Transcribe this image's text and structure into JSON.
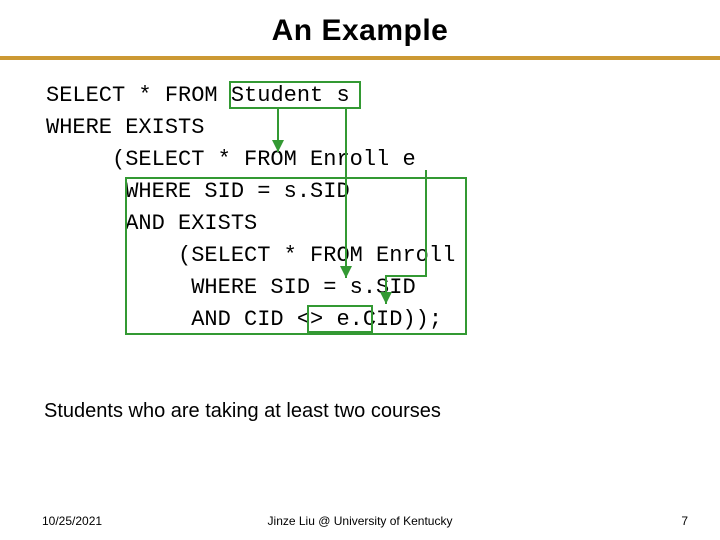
{
  "title": "An Example",
  "code": {
    "l1a": "SELECT * FROM ",
    "l1b": "Student s",
    "l2": "WHERE EXISTS",
    "l3": "     (SELECT * FROM Enroll e",
    "l4": "      WHERE SID = s.SID",
    "l5": "      AND EXISTS",
    "l6": "          (SELECT * FROM Enroll",
    "l7": "           WHERE SID = s.SID",
    "l8": "           AND CID <> e.CID));"
  },
  "caption": "Students who are taking at least two courses",
  "footer": {
    "date": "10/25/2021",
    "credit": "Jinze Liu @ University of Kentucky",
    "pageno": "7"
  },
  "colors": {
    "rule": "#cc9933",
    "box_stroke": "#339933",
    "arrow": "#339933"
  }
}
